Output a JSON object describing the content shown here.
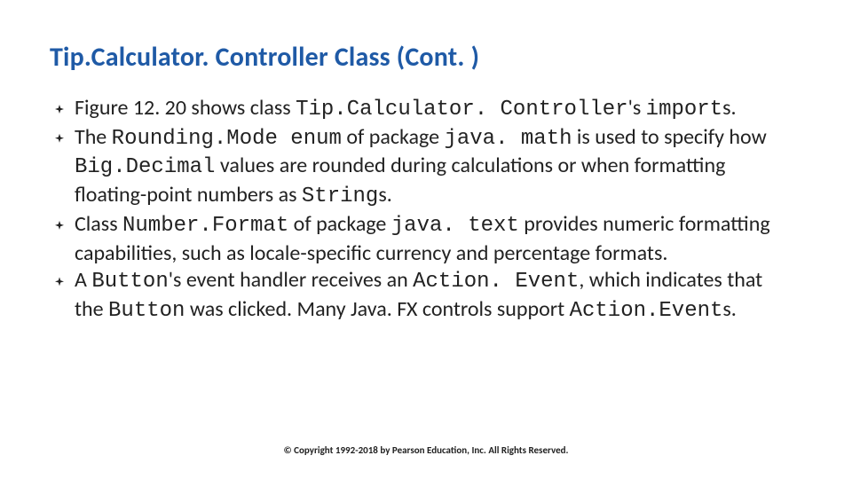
{
  "title": "Tip.Calculator. Controller Class (Cont. )",
  "bullets": [
    {
      "segments": [
        {
          "t": "Figure 12. 20 shows class "
        },
        {
          "t": "Tip.Calculator. Controller",
          "code": true
        },
        {
          "t": "'s "
        },
        {
          "t": "import",
          "code": true
        },
        {
          "t": "s."
        }
      ]
    },
    {
      "segments": [
        {
          "t": "The "
        },
        {
          "t": "Rounding.Mode enum",
          "code": true
        },
        {
          "t": " of package "
        },
        {
          "t": "java. math",
          "code": true
        },
        {
          "t": " is used to specify how "
        },
        {
          "t": "Big.Decimal",
          "code": true
        },
        {
          "t": " values are rounded during calculations or when formatting floating-point numbers as "
        },
        {
          "t": "String",
          "code": true
        },
        {
          "t": "s."
        }
      ]
    },
    {
      "segments": [
        {
          "t": "Class "
        },
        {
          "t": "Number.Format",
          "code": true
        },
        {
          "t": " of package "
        },
        {
          "t": "java. text",
          "code": true
        },
        {
          "t": " provides numeric formatting capabilities, such as locale-specific currency and percentage formats."
        }
      ]
    },
    {
      "segments": [
        {
          "t": "A "
        },
        {
          "t": "Button",
          "code": true
        },
        {
          "t": "'s event handler receives an "
        },
        {
          "t": "Action. Event",
          "code": true
        },
        {
          "t": ", which indicates that the "
        },
        {
          "t": "Button",
          "code": true
        },
        {
          "t": " was clicked. Many Java. FX controls support "
        },
        {
          "t": "Action.Event",
          "code": true
        },
        {
          "t": "s."
        }
      ]
    }
  ],
  "footer": "© Copyright 1992-2018 by Pearson Education, Inc. All Rights Reserved."
}
